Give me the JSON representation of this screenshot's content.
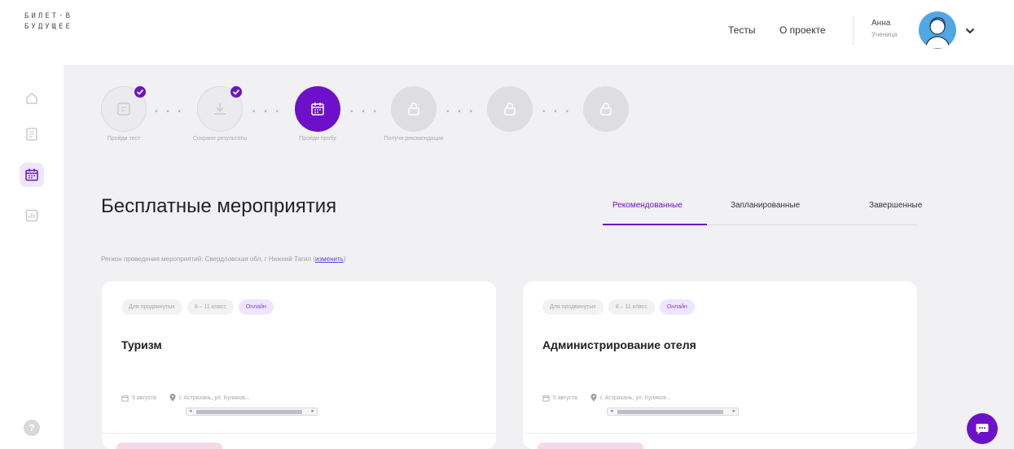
{
  "logo": {
    "line1": "БИЛЕТ·В",
    "line2": "БУДУЩЕЕ"
  },
  "header": {
    "nav": [
      "Тесты",
      "О проекте"
    ],
    "user": {
      "name": "Анна",
      "role": "Ученица"
    }
  },
  "steps": [
    {
      "label": "Пройди тест",
      "state": "done",
      "icon": "test-icon"
    },
    {
      "label": "Сохрани результаты",
      "state": "done",
      "icon": "download-icon"
    },
    {
      "label": "Пройди пробу",
      "state": "current",
      "icon": "calendar-icon"
    },
    {
      "label": "Получи рекомендации",
      "state": "locked",
      "icon": "lock-icon"
    },
    {
      "label": "",
      "state": "locked",
      "icon": "lock-icon"
    },
    {
      "label": "",
      "state": "locked",
      "icon": "lock-icon"
    }
  ],
  "page": {
    "title": "Бесплатные мероприятия",
    "tabs": [
      "Рекомендованные",
      "Запланированные",
      "Завершенные"
    ],
    "region_text": "Регион проведения мероприятий: Свердловская обл, г Нижний Тагил",
    "region_link": "изменить"
  },
  "cards": [
    {
      "tags": [
        "Для продвинутых",
        "8 – 11 класс",
        "Онлайн"
      ],
      "title": "Туризм",
      "date": "5 августа",
      "location": "г. Астрахань, ул. Куликов..."
    },
    {
      "tags": [
        "Для продвинутых",
        "8 – 11 класс",
        "Онлайн"
      ],
      "title": "Администрирование отеля",
      "date": "5 августа",
      "location": "г. Астрахань, ул. Куликов..."
    }
  ],
  "colors": {
    "accent": "#6c11c9",
    "accent_light": "#efe5ff"
  }
}
